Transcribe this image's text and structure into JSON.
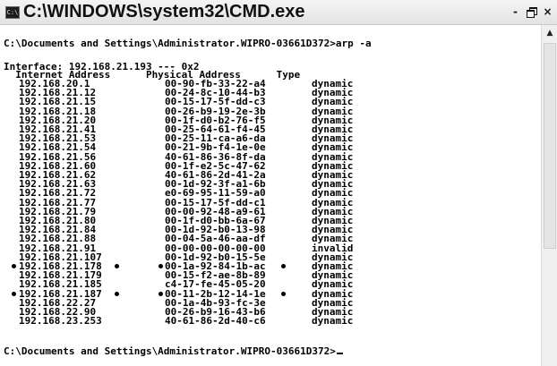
{
  "window": {
    "title": "C:\\WINDOWS\\system32\\CMD.exe",
    "icon_text": "C:\\",
    "controls": {
      "minimize": "-",
      "close": "×"
    }
  },
  "console": {
    "prompt_line": "C:\\Documents and Settings\\Administrator.WIPRO-03661D372>arp -a",
    "interface_line": "Interface: 192.168.21.193 --- 0x2",
    "header_line": "  Internet Address      Physical Address      Type",
    "final_prompt": "C:\\Documents and Settings\\Administrator.WIPRO-03661D372>",
    "entries": [
      {
        "ip": "192.168.20.1",
        "mac": "00-90-fb-33-22-a4",
        "type": "dynamic",
        "marked": false
      },
      {
        "ip": "192.168.21.12",
        "mac": "00-24-8c-10-44-b3",
        "type": "dynamic",
        "marked": false
      },
      {
        "ip": "192.168.21.15",
        "mac": "00-15-17-5f-dd-c3",
        "type": "dynamic",
        "marked": false
      },
      {
        "ip": "192.168.21.18",
        "mac": "00-26-b9-19-2e-3b",
        "type": "dynamic",
        "marked": false
      },
      {
        "ip": "192.168.21.20",
        "mac": "00-1f-d0-b2-76-f5",
        "type": "dynamic",
        "marked": false
      },
      {
        "ip": "192.168.21.41",
        "mac": "00-25-64-61-f4-45",
        "type": "dynamic",
        "marked": false
      },
      {
        "ip": "192.168.21.53",
        "mac": "00-25-11-ca-a6-da",
        "type": "dynamic",
        "marked": false
      },
      {
        "ip": "192.168.21.54",
        "mac": "00-21-9b-f4-1e-0e",
        "type": "dynamic",
        "marked": false
      },
      {
        "ip": "192.168.21.56",
        "mac": "40-61-86-36-8f-da",
        "type": "dynamic",
        "marked": false
      },
      {
        "ip": "192.168.21.60",
        "mac": "00-1f-e2-5c-47-62",
        "type": "dynamic",
        "marked": false
      },
      {
        "ip": "192.168.21.62",
        "mac": "40-61-86-2d-41-2a",
        "type": "dynamic",
        "marked": false
      },
      {
        "ip": "192.168.21.63",
        "mac": "00-1d-92-3f-a1-6b",
        "type": "dynamic",
        "marked": false
      },
      {
        "ip": "192.168.21.72",
        "mac": "e0-69-95-11-59-a0",
        "type": "dynamic",
        "marked": false
      },
      {
        "ip": "192.168.21.77",
        "mac": "00-15-17-5f-dd-c1",
        "type": "dynamic",
        "marked": false
      },
      {
        "ip": "192.168.21.79",
        "mac": "00-00-92-48-a9-61",
        "type": "dynamic",
        "marked": false
      },
      {
        "ip": "192.168.21.80",
        "mac": "00-1f-d0-bb-6a-67",
        "type": "dynamic",
        "marked": false
      },
      {
        "ip": "192.168.21.84",
        "mac": "00-1d-92-b0-13-98",
        "type": "dynamic",
        "marked": false
      },
      {
        "ip": "192.168.21.88",
        "mac": "00-04-5a-46-aa-df",
        "type": "dynamic",
        "marked": false
      },
      {
        "ip": "192.168.21.91",
        "mac": "00-00-00-00-00-00",
        "type": "invalid",
        "marked": false
      },
      {
        "ip": "192.168.21.107",
        "mac": "00-1d-92-b0-15-5e",
        "type": "dynamic",
        "marked": false
      },
      {
        "ip": "192.168.21.178",
        "mac": "00-1a-92-84-1b-ac",
        "type": "dynamic",
        "marked": true
      },
      {
        "ip": "192.168.21.179",
        "mac": "00-15-f2-ae-8b-89",
        "type": "dynamic",
        "marked": false
      },
      {
        "ip": "192.168.21.185",
        "mac": "c4-17-fe-45-05-20",
        "type": "dynamic",
        "marked": false
      },
      {
        "ip": "192.168.21.187",
        "mac": "00-11-2b-12-14-1e",
        "type": "dynamic",
        "marked": true
      },
      {
        "ip": "192.168.22.27",
        "mac": "00-1a-4b-93-fc-3e",
        "type": "dynamic",
        "marked": false
      },
      {
        "ip": "192.168.22.90",
        "mac": "00-26-b9-16-43-b6",
        "type": "dynamic",
        "marked": false
      },
      {
        "ip": "192.168.23.253",
        "mac": "40-61-86-2d-40-c6",
        "type": "dynamic",
        "marked": false
      }
    ]
  },
  "scrollbar": {
    "up_arrow": "▲"
  }
}
